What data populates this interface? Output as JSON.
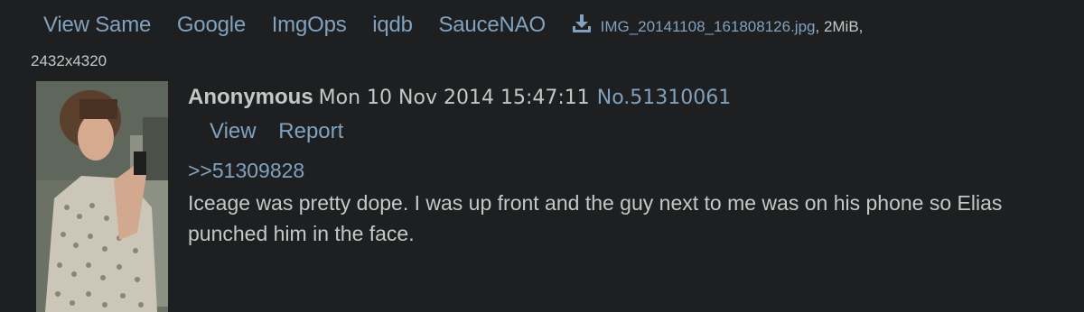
{
  "colors": {
    "background": "#1d1f21",
    "text": "#c5c8c6",
    "link": "#81a2be",
    "accent": "#5f89ac"
  },
  "file": {
    "tools": [
      "View Same",
      "Google",
      "ImgOps",
      "iqdb",
      "SauceNAO"
    ],
    "download_icon": "download-icon",
    "name": "IMG_20141108_161808126.jpg",
    "size": ", 2MiB,",
    "dimensions": "2432x4320"
  },
  "post": {
    "name": "Anonymous",
    "datetime": "Mon 10 Nov 2014 15:47:11",
    "number": "No.51310061",
    "actions": [
      "View",
      "Report"
    ],
    "quote": ">>51309828",
    "message": "Iceage was pretty dope. I was up front and the guy next to me was on his phone so Elias punched him in the face."
  }
}
